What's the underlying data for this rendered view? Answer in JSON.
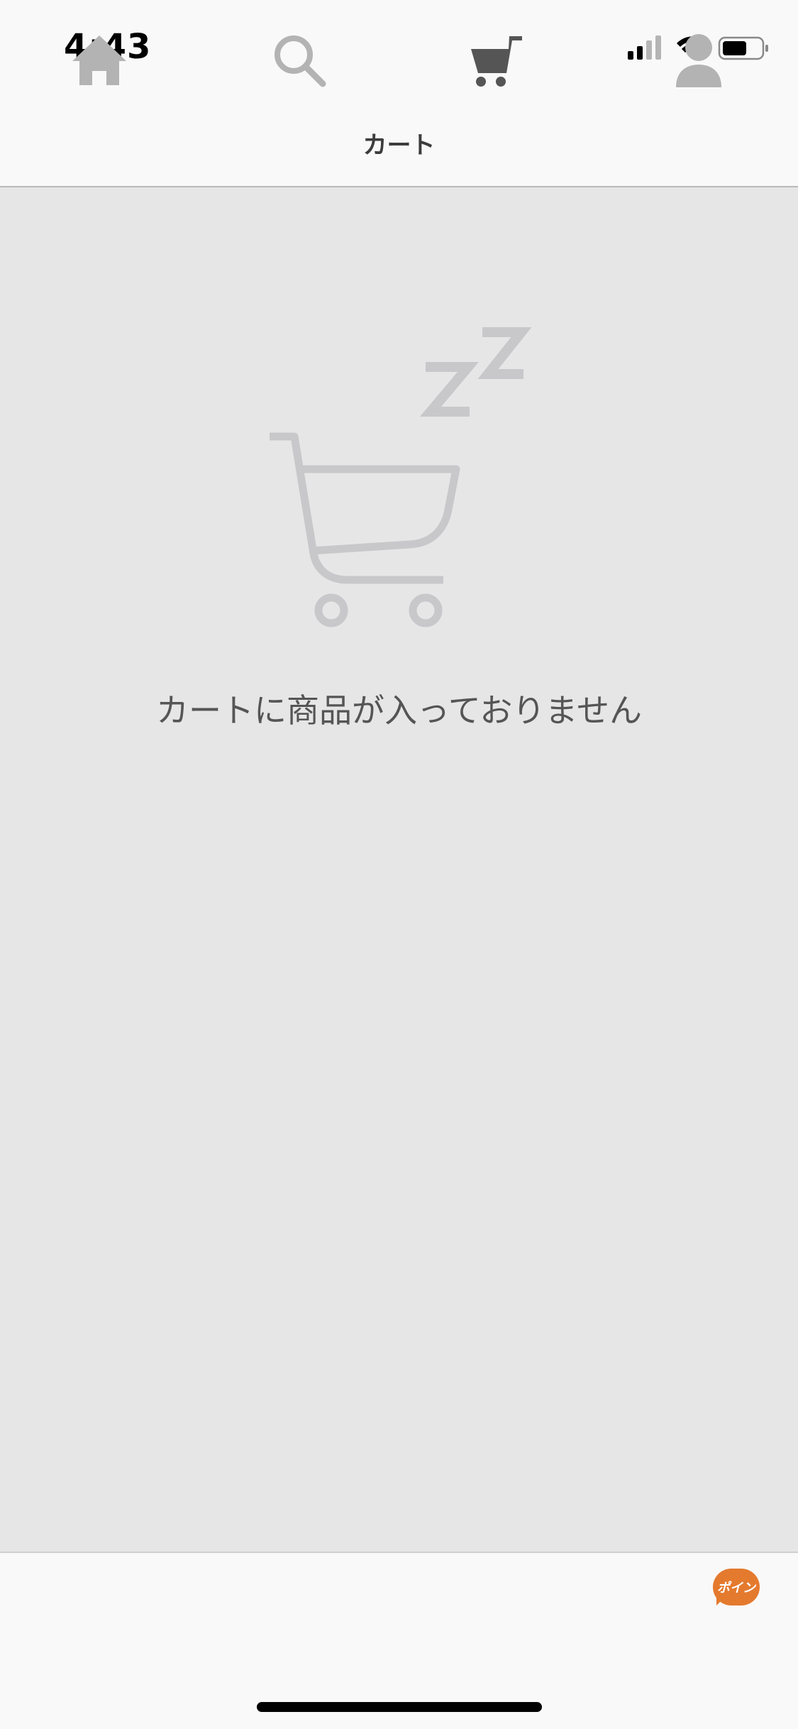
{
  "status_bar": {
    "time": "4:43"
  },
  "nav": {
    "title": "カート"
  },
  "empty_state": {
    "message": "カートに商品が入っておりません",
    "illustration_icon": "sleeping-cart-icon"
  },
  "tab_bar": {
    "tabs": [
      {
        "icon": "home-icon",
        "active": false
      },
      {
        "icon": "search-icon",
        "active": false
      },
      {
        "icon": "cart-icon",
        "active": true
      },
      {
        "icon": "user-icon",
        "active": false
      }
    ],
    "badge": "ポイン"
  },
  "colors": {
    "background": "#e6e6e7",
    "bar_background": "#f9f9f9",
    "icon_inactive": "#b3b3b3",
    "icon_active": "#555555",
    "badge": "#e47a2e",
    "illustration": "#c8c8cb"
  }
}
